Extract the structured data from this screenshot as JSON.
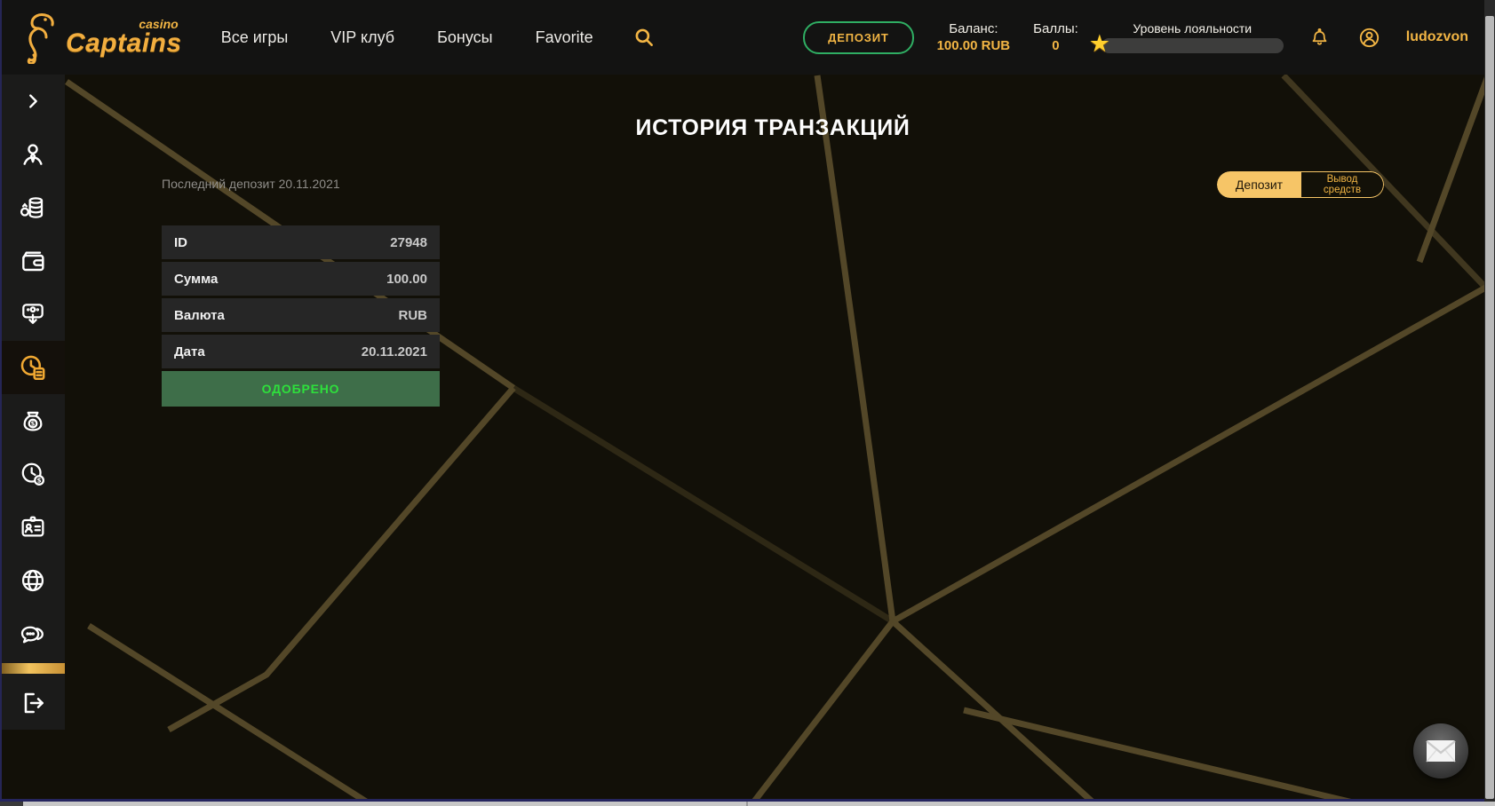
{
  "brand": {
    "name": "Captains",
    "sub": "casino"
  },
  "nav": {
    "items": [
      {
        "label": "Все игры"
      },
      {
        "label": "VIP клуб"
      },
      {
        "label": "Бонусы"
      },
      {
        "label": "Favorite"
      }
    ]
  },
  "topbar": {
    "deposit_button": "ДЕПОЗИТ",
    "balance_label": "Баланс:",
    "balance_value": "100.00 RUB",
    "points_label": "Баллы:",
    "points_value": "0",
    "loyalty_label": "Уровень лояльности",
    "loyalty_progress_percent": 0,
    "username": "ludozvon",
    "star_icon": "★"
  },
  "sidebar": {
    "icons": [
      "expand-chevron",
      "profile",
      "deposits",
      "wallet",
      "cashbox-terminal",
      "transaction-history",
      "money-bag",
      "bets-history",
      "documents-id",
      "language-globe",
      "support-chat",
      "logout"
    ],
    "active_icon": "transaction-history"
  },
  "main": {
    "title": "ИСТОРИЯ ТРАНЗАКЦИЙ",
    "last_deposit": "Последний депозит 20.11.2021",
    "toggle": {
      "deposit": "Депозит",
      "withdraw": "Вывод средств"
    },
    "transaction": {
      "rows": [
        {
          "label": "ID",
          "value": "27948"
        },
        {
          "label": "Сумма",
          "value": "100.00"
        },
        {
          "label": "Валюта",
          "value": "RUB"
        },
        {
          "label": "Дата",
          "value": "20.11.2021"
        }
      ],
      "status": "ОДОБРЕНО"
    }
  },
  "colors": {
    "accent_gold": "#F2B544",
    "deposit_border_green": "#2FAE63",
    "status_bg_green": "#3E6E49",
    "status_text_green": "#2EE03C",
    "row_bg": "#262626",
    "background": "#121008",
    "line_gold": "#5C4E2D"
  }
}
